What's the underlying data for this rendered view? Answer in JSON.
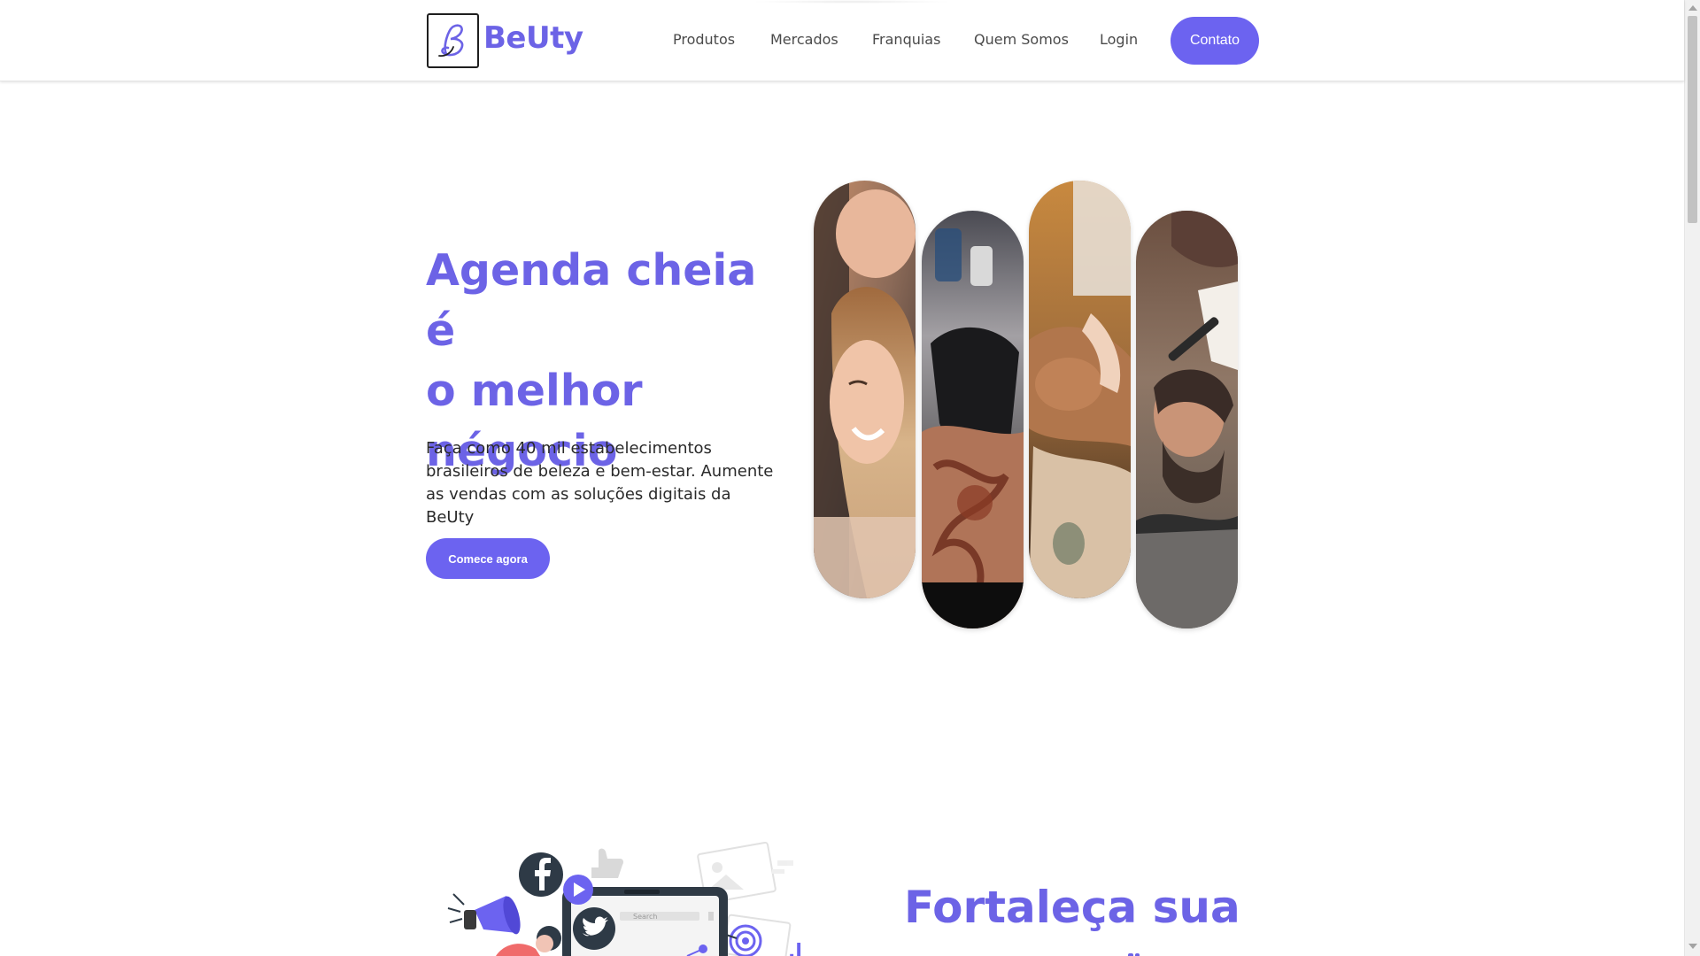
{
  "brand": {
    "logo_letter": "B",
    "name": "BeUty",
    "accent_color": "#6c63e6",
    "button_color": "#6c63f0"
  },
  "nav": {
    "items": [
      "Produtos",
      "Mercados",
      "Franquias",
      "Quem Somos",
      "Login"
    ],
    "contact_label": "Contato"
  },
  "hero": {
    "title_lines": [
      "Agenda cheia é",
      "o melhor",
      "négocio"
    ],
    "description": "Faça como 40 mil estabelecimentos brasileiros de beleza e bem-estar. Aumente as vendas com as soluções digitais da BeUty",
    "cta_label": "Comece agora",
    "photos": [
      "hair-salon-photo",
      "tattoo-photo",
      "facial-treatment-photo",
      "barber-photo"
    ]
  },
  "section2": {
    "title": "Fortaleça sua",
    "illustration": {
      "search_placeholder": "Search",
      "icons": [
        "facebook-icon",
        "play-icon",
        "twitter-icon",
        "megaphone-icon",
        "like-icon",
        "image-icon",
        "target-icon"
      ]
    }
  }
}
